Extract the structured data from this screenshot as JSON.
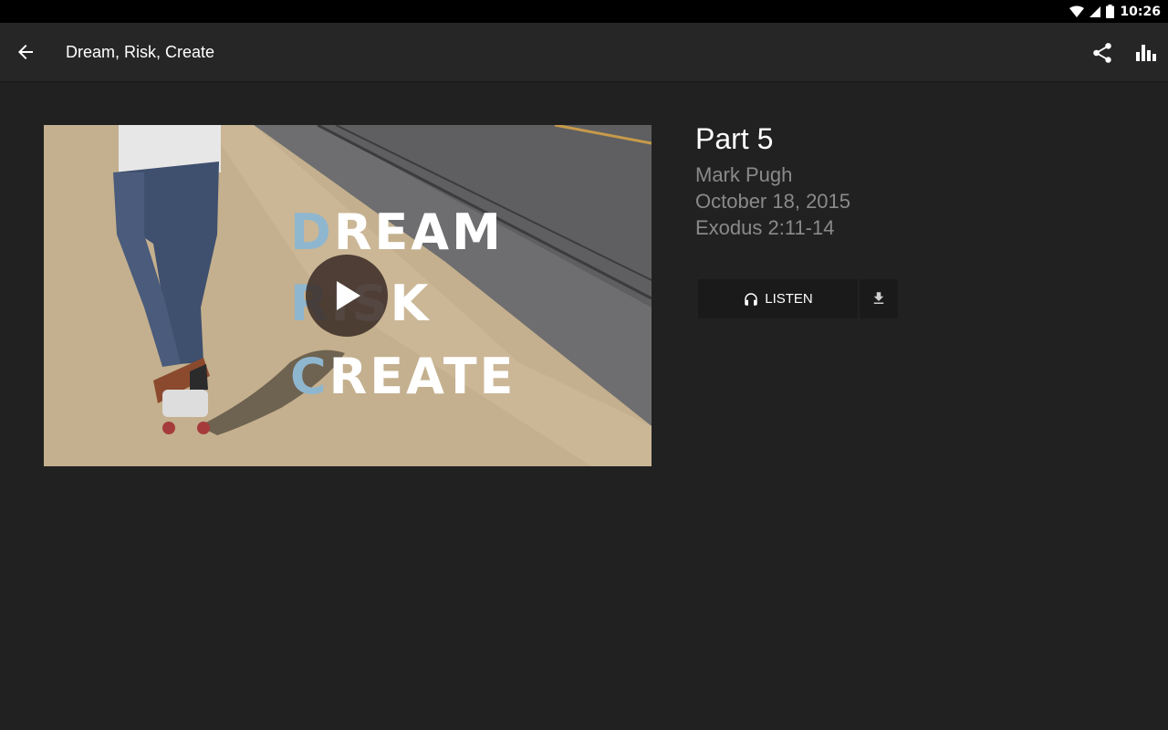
{
  "status_bar": {
    "time": "10:26"
  },
  "app_bar": {
    "title": "Dream, Risk, Create"
  },
  "media": {
    "lines": [
      {
        "initial": "D",
        "rest": "REAM"
      },
      {
        "initial": "R",
        "rest": "ISK"
      },
      {
        "initial": "C",
        "rest": "REATE"
      }
    ]
  },
  "sermon": {
    "title": "Part 5",
    "speaker": "Mark Pugh",
    "date": "October 18, 2015",
    "scripture": "Exodus 2:11-14"
  },
  "actions": {
    "listen_label": "LISTEN"
  },
  "colors": {
    "accent": "#8fb6cf",
    "background": "#212121",
    "appbar": "#262626"
  }
}
